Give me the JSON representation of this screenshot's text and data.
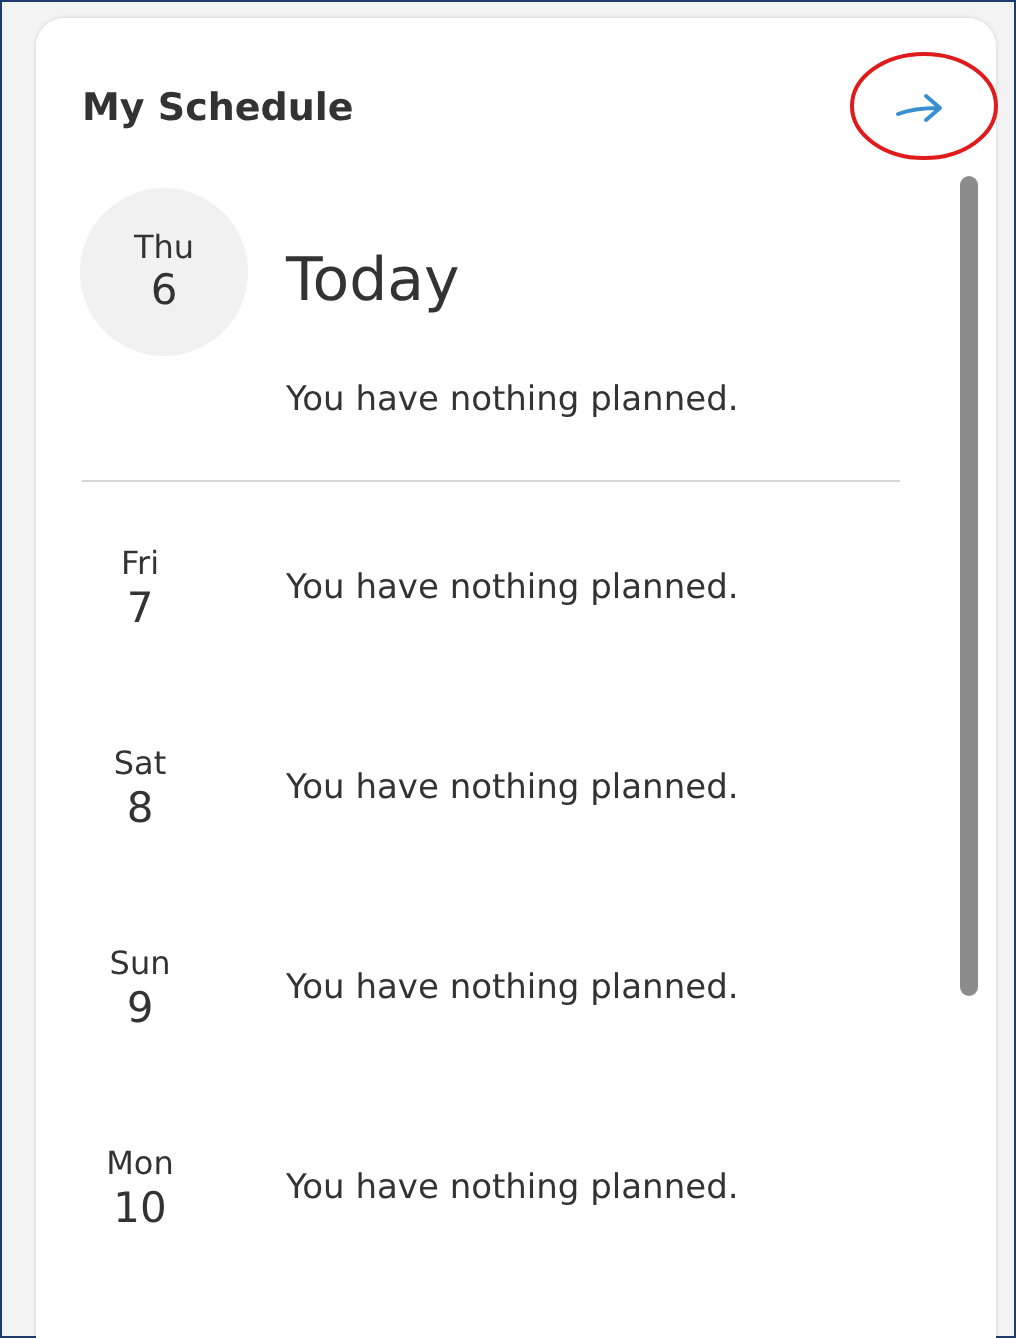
{
  "title": "My Schedule",
  "today": {
    "day": "Thu",
    "date": "6",
    "label": "Today",
    "message": "You have nothing planned."
  },
  "days": [
    {
      "day": "Fri",
      "date": "7",
      "message": "You have nothing planned."
    },
    {
      "day": "Sat",
      "date": "8",
      "message": "You have nothing planned."
    },
    {
      "day": "Sun",
      "date": "9",
      "message": "You have nothing planned."
    },
    {
      "day": "Mon",
      "date": "10",
      "message": "You have nothing planned."
    }
  ]
}
